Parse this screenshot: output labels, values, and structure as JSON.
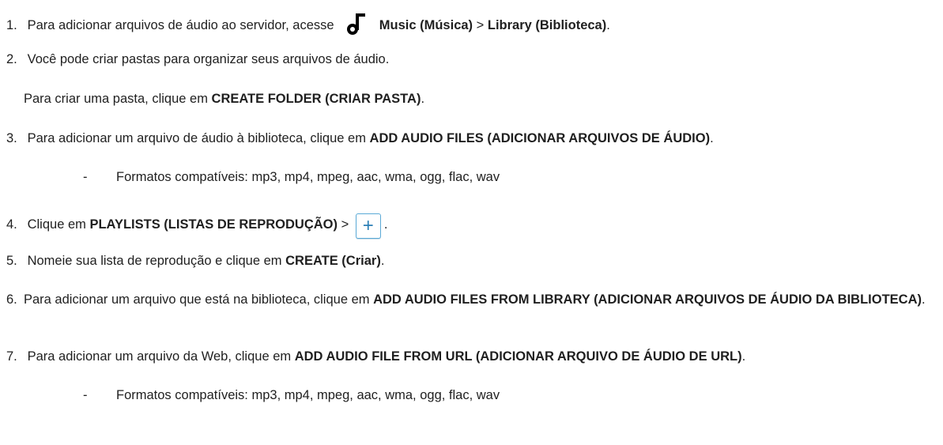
{
  "steps": [
    {
      "num": "1.",
      "text_a": "Para adicionar arquivos de áudio ao servidor, acesse",
      "bold_a": "Music (Música)",
      "sep": " > ",
      "bold_b": "Library (Biblioteca)",
      "end": ".",
      "icon": "music-note-icon"
    },
    {
      "num": "2.",
      "text_a": "Você pode criar pastas para organizar seus arquivos de áudio.",
      "sub_text": "Para criar uma pasta, clique em ",
      "sub_bold": "CREATE FOLDER (CRIAR PASTA)",
      "sub_end": "."
    },
    {
      "num": "3.",
      "text_a": "Para adicionar um arquivo de áudio à biblioteca, clique em ",
      "bold_a": "ADD AUDIO FILES (ADICIONAR ARQUIVOS DE ÁUDIO)",
      "end": ".",
      "bullet_dash": "-",
      "bullet": "Formatos compatíveis: mp3, mp4, mpeg, aac, wma, ogg, flac, wav"
    },
    {
      "num": "4.",
      "text_a": "Clique em ",
      "bold_a": "PLAYLISTS (LISTAS DE REPRODUÇÃO)",
      "sep": " > ",
      "button": "+",
      "end": "."
    },
    {
      "num": "5.",
      "text_a": "Nomeie sua lista de reprodução e clique em ",
      "bold_a": "CREATE (Criar)",
      "end": "."
    },
    {
      "num": "6.",
      "text_a": "Para adicionar um arquivo que está na biblioteca, clique em ",
      "bold_a": "ADD AUDIO FILES FROM LIBRARY (ADICIONAR ARQUIVOS DE ÁUDIO DA BIBLIOTECA)",
      "end": "."
    },
    {
      "num": "7.",
      "text_a": "Para adicionar um arquivo da Web, clique em ",
      "bold_a": "ADD AUDIO FILE FROM URL (ADICIONAR ARQUIVO DE ÁUDIO DE URL)",
      "end": ".",
      "bullet_dash": "-",
      "bullet": "Formatos compatíveis: mp3, mp4, mpeg, aac, wma, ogg, flac, wav"
    }
  ]
}
